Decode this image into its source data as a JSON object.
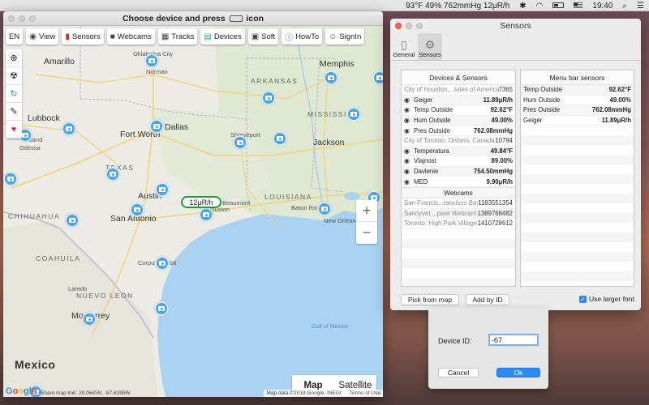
{
  "menubar": {
    "weather": "93°F 49% 762mmHg 12μR/h",
    "clock": "19:40"
  },
  "map_window": {
    "title_prefix": "Choose device and press",
    "title_suffix": "icon",
    "toolbar": {
      "lang": "EN",
      "view": "View",
      "sensors": "Sensors",
      "webcams": "Webcams",
      "tracks": "Tracks",
      "devices": "Devices",
      "soft": "Soft",
      "howto": "HowTo",
      "signin": "SignIn"
    },
    "places": {
      "amarillo": "Amarillo",
      "norman": "Norman",
      "oklahoma_city": "Oklahoma City",
      "memphis": "Memphis",
      "lubbock": "Lubbock",
      "arkansas": "ARKANSAS",
      "mississippi": "MISSISSIPPI",
      "fort_worth": "Fort Worth",
      "dallas": "Dallas",
      "shreveport": "Shreveport",
      "jackson": "Jackson",
      "midland": "Midland",
      "odessa": "Odessa",
      "texas": "TEXAS",
      "austin": "Austin",
      "san_antonio": "San Antonio",
      "beaumont": "Beaumont",
      "houston": "Houston",
      "louisiana": "LOUISIANA",
      "baton_rouge": "Baton Rouge",
      "new_orleans": "New Orleans",
      "laredo": "Laredo",
      "corpus_christi": "Corpus Christi",
      "coahuila": "COAHUILA",
      "nuevo_leon": "NUEVO LEÓN",
      "monterrey": "Monterrey",
      "gulf": "Gulf of Mexico",
      "mexico": "Mexico",
      "chihuahua": "CHIHUAHUA"
    },
    "radiation_bubble": "12μR/h",
    "zoom_in": "+",
    "zoom_out": "−",
    "map_types": {
      "map": "Map",
      "satellite": "Satellite",
      "active": "map"
    },
    "footer": {
      "share": "Share map link: 29.0645N, -87.6395W",
      "attribution": "Map data ©2018 Google, INEGI",
      "terms": "Terms of Use"
    }
  },
  "sensors_window": {
    "title": "Sensors",
    "tabs": [
      {
        "label": "General",
        "selected": false
      },
      {
        "label": "Sensors",
        "selected": true
      }
    ],
    "devices_panel": {
      "header": "Devices & Sensors",
      "groups": [
        {
          "name": "City of Houston,...tates of America",
          "id": "7365",
          "sensors": [
            {
              "label": "Geiger",
              "value": "11.89μR/h"
            },
            {
              "label": "Temp Outside",
              "value": "92.62°F"
            },
            {
              "label": "Hum Outside",
              "value": "49.00%"
            },
            {
              "label": "Pres Outside",
              "value": "762.08mmHg"
            }
          ]
        },
        {
          "name": "City of Toronto, Ontario, Canada",
          "id": "10794",
          "sensors": [
            {
              "label": "Temperatura",
              "value": "49.84°F"
            },
            {
              "label": "Vlajnost",
              "value": "89.00%"
            },
            {
              "label": "Davlenie",
              "value": "754.50mmHg"
            },
            {
              "label": "MED",
              "value": "9.90μR/h"
            }
          ]
        }
      ],
      "webcams_header": "Webcams",
      "webcams": [
        {
          "name": "San-Francis...rancisco Bay",
          "id": "1183551354"
        },
        {
          "name": "Sannyvel:...pixel Webcam",
          "id": "1389768482"
        },
        {
          "name": "Toronto: High Park Village",
          "id": "1410728612"
        }
      ]
    },
    "menubar_panel": {
      "header": "Menu bar sensors",
      "sensors": [
        {
          "label": "Temp Outside",
          "value": "92.62°F"
        },
        {
          "label": "Hum Outside",
          "value": "49.00%"
        },
        {
          "label": "Pres Outside",
          "value": "762.08mmHg"
        },
        {
          "label": "Geiger",
          "value": "11.89μR/h"
        }
      ]
    },
    "buttons": {
      "pick_from_map": "Pick from map",
      "add_by_id": "Add by ID"
    },
    "use_larger_font": {
      "label": "Use larger font",
      "checked": true
    }
  },
  "device_sheet": {
    "label": "Device ID:",
    "value": "-67",
    "cancel": "Cancel",
    "ok": "Ok"
  },
  "colors": {
    "accent": "#2a8af6",
    "camera_marker": "#4ba3ea",
    "radiation_ok": "#1e9e33",
    "water": "#a9d2f3"
  }
}
